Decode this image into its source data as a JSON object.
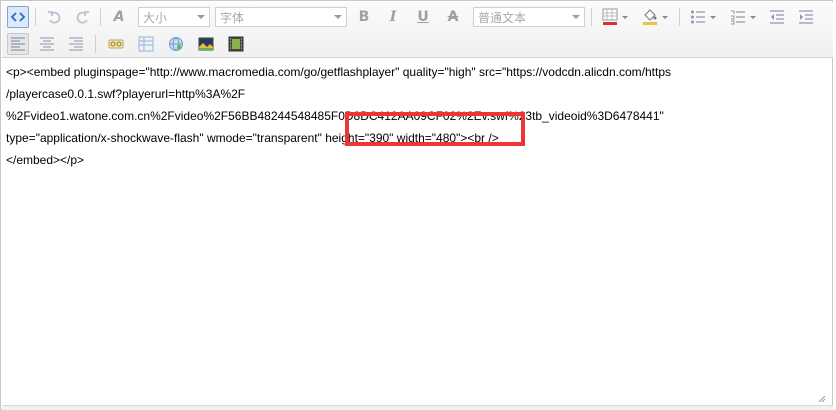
{
  "toolbar": {
    "font_size_placeholder": "大小",
    "font_family_placeholder": "字体",
    "paragraph_format": "普通文本",
    "bold_glyph": "B",
    "italic_glyph": "I",
    "underline_glyph": "U",
    "strike_glyph": "A",
    "format_painter_glyph": "A",
    "colors": {
      "font_color": "#e03030",
      "highlight_color": "#f0c040",
      "active_border": "#7ea5d8"
    }
  },
  "content": {
    "lines": [
      "<p><embed pluginspage=\"http://www.macromedia.com/go/getflashplayer\" quality=\"high\" src=\"https://vodcdn.alicdn.com/https",
      "/playercase0.0.1.swf?playerurl=http%3A%2F",
      "%2Fvideo1.watone.com.cn%2Fvideo%2F56BB48244548485F0D8DC412AA09CF02%2Ev.swf%23tb_videoid%3D6478441\"",
      "type=\"application/x-shockwave-flash\" wmode=\"transparent\" height=\"390\" width=\"480\"><br />",
      "</embed></p>"
    ]
  }
}
